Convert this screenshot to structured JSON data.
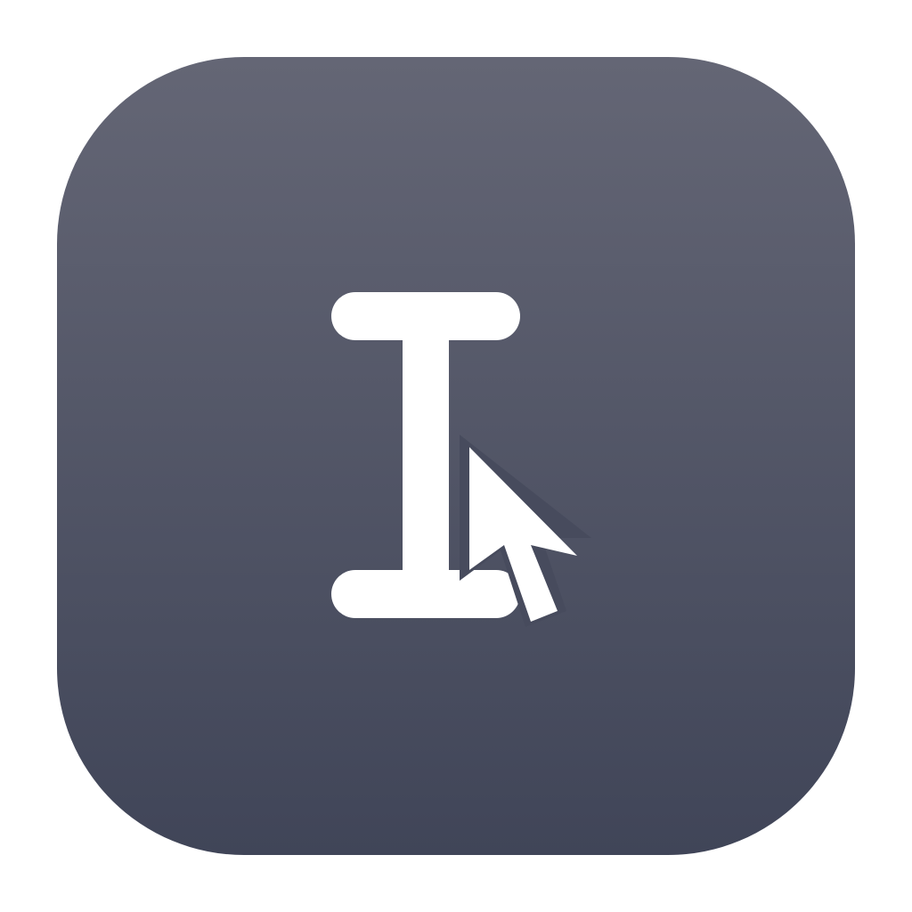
{
  "icon": {
    "name": "text-cursor-app-icon",
    "glyphs": [
      "text-cursor-i-beam-icon",
      "mouse-pointer-arrow-icon"
    ]
  },
  "colors": {
    "page_background": "#ffffff",
    "tile_gradient_top": "#646675",
    "tile_gradient_bottom": "#404558",
    "glyph_fill": "#ffffff"
  }
}
